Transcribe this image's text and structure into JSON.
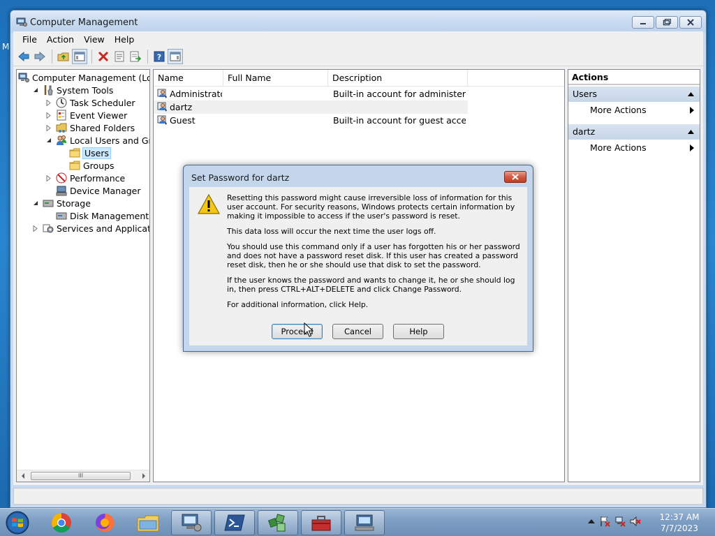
{
  "desktop": {
    "edge_letter": "M"
  },
  "window": {
    "title": "Computer Management",
    "controls": {
      "minimize": "minimize",
      "restore": "restore",
      "close": "close"
    }
  },
  "menu": {
    "file": "File",
    "action": "Action",
    "view": "View",
    "help": "Help"
  },
  "toolbar": {
    "icons": [
      "back-arrow-icon",
      "forward-arrow-icon",
      "up-folder-icon",
      "show-hide-tree-icon",
      "delete-icon",
      "properties-icon",
      "export-list-icon",
      "help-icon",
      "show-hide-action-pane-icon"
    ]
  },
  "tree": {
    "items": [
      {
        "label": "Computer Management (Local",
        "level": 0,
        "expander": "none",
        "icon": "computer-management-icon"
      },
      {
        "label": "System Tools",
        "level": 1,
        "expander": "expanded",
        "icon": "tools-icon"
      },
      {
        "label": "Task Scheduler",
        "level": 2,
        "expander": "collapsed",
        "icon": "clock-icon"
      },
      {
        "label": "Event Viewer",
        "level": 2,
        "expander": "collapsed",
        "icon": "event-viewer-icon"
      },
      {
        "label": "Shared Folders",
        "level": 2,
        "expander": "collapsed",
        "icon": "shared-folder-icon"
      },
      {
        "label": "Local Users and Groups",
        "level": 2,
        "expander": "expanded",
        "icon": "users-groups-icon"
      },
      {
        "label": "Users",
        "level": 3,
        "expander": "none",
        "icon": "folder-icon",
        "selected": true
      },
      {
        "label": "Groups",
        "level": 3,
        "expander": "none",
        "icon": "folder-icon"
      },
      {
        "label": "Performance",
        "level": 2,
        "expander": "collapsed",
        "icon": "performance-icon"
      },
      {
        "label": "Device Manager",
        "level": 2,
        "expander": "none",
        "icon": "device-manager-icon"
      },
      {
        "label": "Storage",
        "level": 1,
        "expander": "expanded",
        "icon": "storage-icon"
      },
      {
        "label": "Disk Management",
        "level": 2,
        "expander": "none",
        "icon": "disk-icon"
      },
      {
        "label": "Services and Applications",
        "level": 1,
        "expander": "collapsed",
        "icon": "services-icon"
      }
    ],
    "scroll_thumb": "III"
  },
  "list": {
    "columns": {
      "name": "Name",
      "full_name": "Full Name",
      "description": "Description"
    },
    "rows": [
      {
        "name": "Administrator",
        "full_name": "",
        "description": "Built-in account for administering..."
      },
      {
        "name": "dartz",
        "full_name": "",
        "description": ""
      },
      {
        "name": "Guest",
        "full_name": "",
        "description": "Built-in account for guest access t..."
      }
    ]
  },
  "actions": {
    "title": "Actions",
    "sections": [
      {
        "title": "Users",
        "item": "More Actions"
      },
      {
        "title": "dartz",
        "item": "More Actions"
      }
    ]
  },
  "dialog": {
    "title": "Set Password for dartz",
    "paragraphs": [
      "Resetting this password might cause irreversible loss of information for this user account. For security reasons, Windows protects certain information by making it impossible to access if the user's password is reset.",
      "This data loss will occur the next time the user logs off.",
      "You should use this command only if a user has forgotten his or her password and does not have a password reset disk. If this user has created a password reset disk, then he or she should use that disk to set the password.",
      "If the user knows the password and wants to change it, he or she should log in, then press CTRL+ALT+DELETE and click Change Password.",
      "For additional information, click Help."
    ],
    "buttons": {
      "proceed": "Proceed",
      "cancel": "Cancel",
      "help": "Help"
    }
  },
  "taskbar": {
    "apps": [
      "chrome-icon",
      "firefox-icon",
      "file-explorer-icon",
      "computer-management-icon",
      "powershell-icon",
      "installer-icon",
      "toolbox-icon",
      "network-computer-icon"
    ],
    "clock": {
      "time": "12:37 AM",
      "date": "7/7/2023"
    }
  }
}
